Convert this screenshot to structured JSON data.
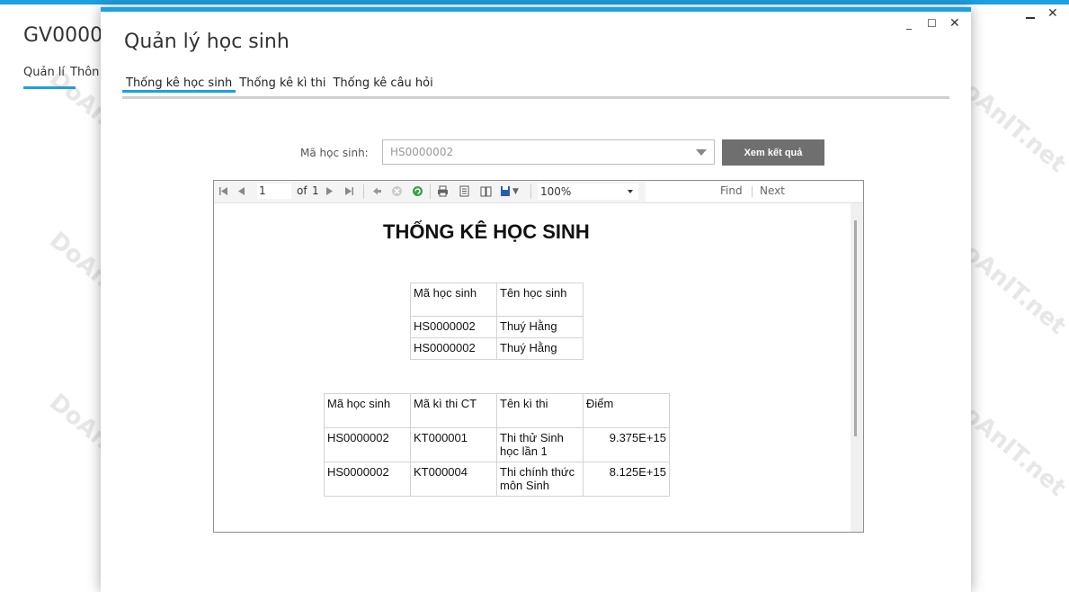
{
  "background_window": {
    "title": "GV00000",
    "tabs": [
      "Quản lí",
      "Thôn"
    ]
  },
  "dialog": {
    "title": "Quản lý học sinh",
    "tabs": [
      {
        "label": "Thống kê học sinh",
        "active": true
      },
      {
        "label": "Thống kê kì thi",
        "active": false
      },
      {
        "label": "Thống kê câu hỏi",
        "active": false
      }
    ],
    "student_label": "Mã học sinh:",
    "student_value": "HS0000002",
    "view_button": "Xem kết quả"
  },
  "viewer": {
    "page_current": "1",
    "page_of": "of",
    "page_total": "1",
    "zoom": "100%",
    "find_label": "Find",
    "next_label": "Next"
  },
  "report": {
    "title": "THỐNG KÊ HỌC SINH",
    "table1": {
      "headers": [
        "Mã học sinh",
        "Tên học sinh"
      ],
      "rows": [
        [
          "HS0000002",
          "Thuý Hằng"
        ],
        [
          "HS0000002",
          "Thuý Hằng"
        ]
      ]
    },
    "table2": {
      "headers": [
        "Mã học sinh",
        "Mã kì thi CT",
        "Tên kì thi",
        "Điểm"
      ],
      "rows": [
        [
          "HS0000002",
          "KT000001",
          "Thi thử Sinh học lần 1",
          "9.375E+15"
        ],
        [
          "HS0000002",
          "KT000004",
          "Thi chính thức môn Sinh",
          "8.125E+15"
        ]
      ]
    }
  },
  "watermark": "DoAnIT.net",
  "colors": {
    "accent": "#1ba1e2",
    "button": "#6f6f6f"
  }
}
